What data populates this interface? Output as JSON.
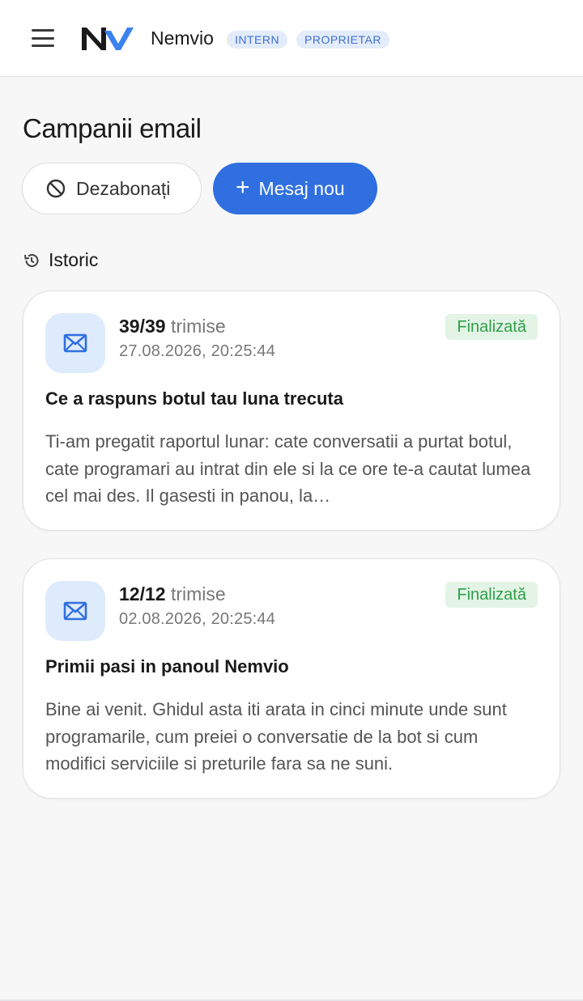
{
  "header": {
    "app_name": "Nemvio",
    "badges": [
      "INTERN",
      "PROPRIETAR"
    ],
    "menu_icon": "hamburger-menu-icon",
    "logo_icon": "nemvio-logo"
  },
  "page": {
    "title": "Campanii email",
    "unsubscribed_label": "Dezabonați",
    "new_message_label": "Mesaj nou",
    "new_message_icon": "+",
    "history_label": "Istoric"
  },
  "colors": {
    "accent": "#2f6fe0",
    "badge_bg": "#e3ecfb",
    "status_bg": "#e3f4e6",
    "status_text": "#2f9e4a"
  },
  "campaigns": [
    {
      "count": "39/39",
      "sent_label": "trimise",
      "date": "27.08.2026, 20:25:44",
      "status": "Finalizată",
      "subject": "Ce a raspuns botul tau luna trecuta",
      "preview": "Ti-am pregatit raportul lunar: cate conversatii a purtat botul, cate programari au intrat din ele si la ce ore te-a cautat lumea cel mai des. Il gasesti in panou, la…"
    },
    {
      "count": "12/12",
      "sent_label": "trimise",
      "date": "02.08.2026, 20:25:44",
      "status": "Finalizată",
      "subject": "Primii pasi in panoul Nemvio",
      "preview": "Bine ai venit. Ghidul asta iti arata in cinci minute unde sunt programarile, cum preiei o conversatie de la bot si cum modifici serviciile si preturile fara sa ne suni."
    }
  ]
}
